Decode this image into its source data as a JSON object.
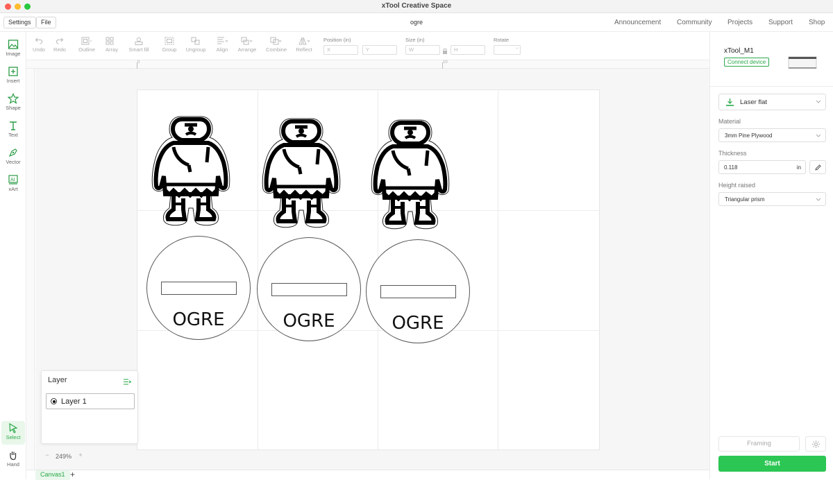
{
  "window": {
    "app_title": "xTool Creative Space",
    "document_name": "ogre"
  },
  "menu": {
    "settings": "Settings",
    "file": "File"
  },
  "nav": [
    "Announcement",
    "Community",
    "Projects",
    "Support",
    "Shop"
  ],
  "left_tools": [
    {
      "label": "Image",
      "icon": "image-icon"
    },
    {
      "label": "Insert",
      "icon": "insert-icon"
    },
    {
      "label": "Shape",
      "icon": "shape-icon"
    },
    {
      "label": "Text",
      "icon": "text-icon"
    },
    {
      "label": "Vector",
      "icon": "pen-icon"
    },
    {
      "label": "xArt",
      "icon": "ai-icon"
    }
  ],
  "bottom_tools": [
    {
      "label": "Select",
      "icon": "cursor-icon",
      "active": true
    },
    {
      "label": "Hand",
      "icon": "hand-icon",
      "active": false
    }
  ],
  "toolbar": {
    "undo": "Undo",
    "redo": "Redo",
    "outline": "Outline",
    "array": "Array",
    "smart_fill": "Smart fill",
    "group": "Group",
    "ungroup": "Ungroup",
    "align": "Align",
    "arrange": "Arrange",
    "combine": "Combine",
    "reflect": "Reflect",
    "position_label": "Position (in)",
    "x_placeholder": "X",
    "y_placeholder": "Y",
    "size_label": "Size (in)",
    "w_placeholder": "W",
    "h_placeholder": "H",
    "rotate_label": "Rotate"
  },
  "ruler": {
    "top_marks": [
      "0",
      "10"
    ]
  },
  "canvas": {
    "tokens": [
      {
        "text": "OGRE"
      },
      {
        "text": "OGRE"
      },
      {
        "text": "OGRE"
      }
    ]
  },
  "layer_panel": {
    "title": "Layer",
    "layers": [
      "Layer 1"
    ]
  },
  "zoom": {
    "value": "249%",
    "minus": "−",
    "plus": "+"
  },
  "tabs": {
    "items": [
      "Canvas1"
    ],
    "add": "+"
  },
  "right_panel": {
    "device_name": "xTool_M1",
    "connect": "Connect device",
    "process": "Laser flat",
    "material_label": "Material",
    "material": "3mm Pine Plywood",
    "thickness_label": "Thickness",
    "thickness_value": "0.118",
    "thickness_unit": "in",
    "height_label": "Height raised",
    "height_value": "Triangular prism",
    "framing": "Framing",
    "start": "Start"
  },
  "colors": {
    "accent": "#2bc653",
    "accent_text": "#2aa84a"
  }
}
